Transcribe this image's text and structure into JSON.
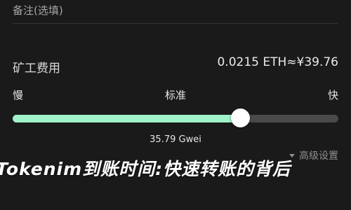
{
  "note": {
    "label": "备注(选填)"
  },
  "fee": {
    "label": "矿工费用",
    "value": "0.0215 ETH≈¥39.76"
  },
  "speed": {
    "slow": "慢",
    "standard": "标准",
    "fast": "快",
    "slider_level": 0.7
  },
  "gas_price": "35.79 Gwei",
  "advanced": {
    "label": "高级设置",
    "icon": "chevron-down-icon"
  },
  "watermark": "Tokenim到账时间:快速转账的背后"
}
